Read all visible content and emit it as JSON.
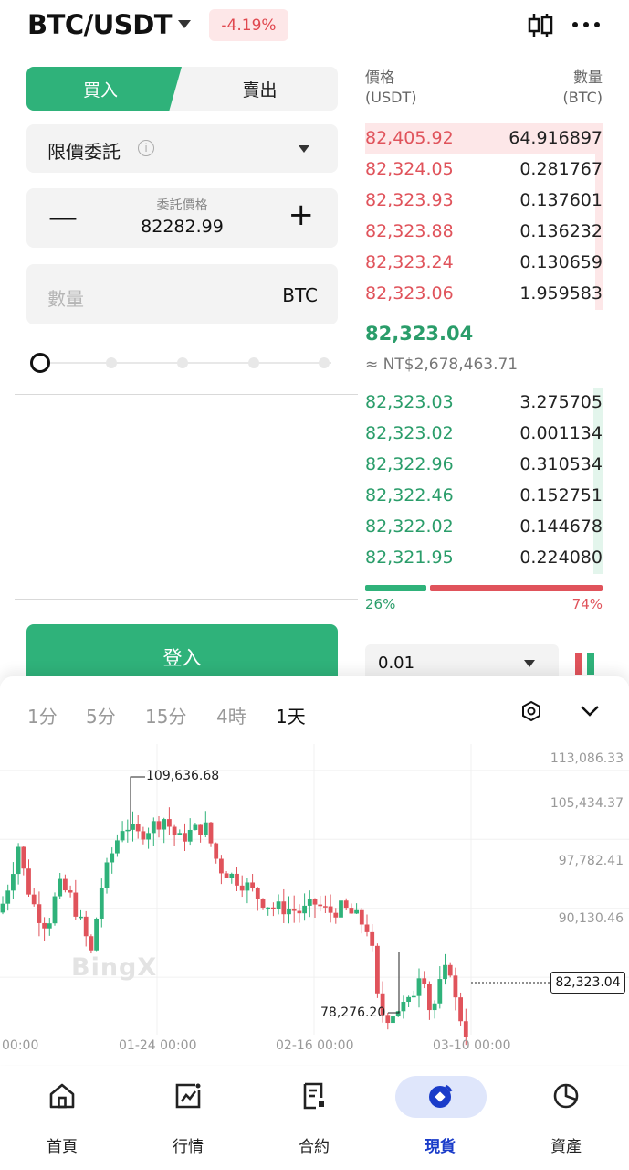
{
  "header": {
    "pair": "BTC/USDT",
    "change": "-4.19%"
  },
  "trade": {
    "buy_tab": "買入",
    "sell_tab": "賣出",
    "order_type": "限價委託",
    "price_caption": "委託價格",
    "price_value": "82282.99",
    "minus": "—",
    "plus": "+",
    "qty_placeholder": "數量",
    "qty_unit": "BTC",
    "login_button": "登入"
  },
  "orderbook": {
    "price_header": "價格",
    "price_unit": "(USDT)",
    "qty_header": "數量",
    "qty_unit": "(BTC)",
    "asks": [
      {
        "price": "82,405.92",
        "qty": "64.916897",
        "depth": 1.0
      },
      {
        "price": "82,324.05",
        "qty": "0.281767",
        "depth": 0.03
      },
      {
        "price": "82,323.93",
        "qty": "0.137601",
        "depth": 0.03
      },
      {
        "price": "82,323.88",
        "qty": "0.136232",
        "depth": 0.03
      },
      {
        "price": "82,323.24",
        "qty": "0.130659",
        "depth": 0.03
      },
      {
        "price": "82,323.06",
        "qty": "1.959583",
        "depth": 0.03
      }
    ],
    "last_price": "82,323.04",
    "fiat_price": "≈ NT$2,678,463.71",
    "bids": [
      {
        "price": "82,323.03",
        "qty": "3.275705",
        "depth": 0.04
      },
      {
        "price": "82,323.02",
        "qty": "0.001134",
        "depth": 0.04
      },
      {
        "price": "82,322.96",
        "qty": "0.310534",
        "depth": 0.04
      },
      {
        "price": "82,322.46",
        "qty": "0.152751",
        "depth": 0.04
      },
      {
        "price": "82,322.02",
        "qty": "0.144678",
        "depth": 0.04
      },
      {
        "price": "82,321.95",
        "qty": "0.224080",
        "depth": 0.04
      }
    ],
    "buy_ratio": "26%",
    "sell_ratio": "74%",
    "buy_ratio_value": 0.26,
    "depth_step": "0.01"
  },
  "chart": {
    "timeframes": [
      "1分",
      "5分",
      "15分",
      "4時",
      "1天"
    ],
    "active_timeframe": 4,
    "y_labels": [
      "113,086.33",
      "105,434.37",
      "97,782.41",
      "90,130.46"
    ],
    "x_labels": [
      "00:00",
      "01-24 00:00",
      "02-16 00:00",
      "03-10 00:00"
    ],
    "high_annotation": "109,636.68",
    "low_annotation": "78,276.20",
    "current_price": "82,323.04",
    "watermark": "BingX"
  },
  "chart_data": {
    "type": "candlestick",
    "y_ticks": [
      113086.33,
      105434.37,
      97782.41,
      90130.46
    ],
    "ylim": [
      79500,
      115200
    ],
    "x_ticks": [
      "00:00",
      "01-24 00:00",
      "02-16 00:00",
      "03-10 00:00"
    ],
    "high": 109636.68,
    "low": 78276.2,
    "last": 82323.04,
    "colors": {
      "up": "#2fb27a",
      "down": "#e0535b"
    }
  },
  "nav": {
    "items": [
      {
        "label": "首頁",
        "icon": "home-icon"
      },
      {
        "label": "行情",
        "icon": "market-chart-icon"
      },
      {
        "label": "合約",
        "icon": "contract-doc-icon"
      },
      {
        "label": "現貨",
        "icon": "spot-icon"
      },
      {
        "label": "資產",
        "icon": "assets-pie-icon"
      }
    ],
    "active": 3
  },
  "colors": {
    "green": "#2fb27a",
    "red": "#e0535b",
    "nav_active": "#1a3cc9"
  }
}
